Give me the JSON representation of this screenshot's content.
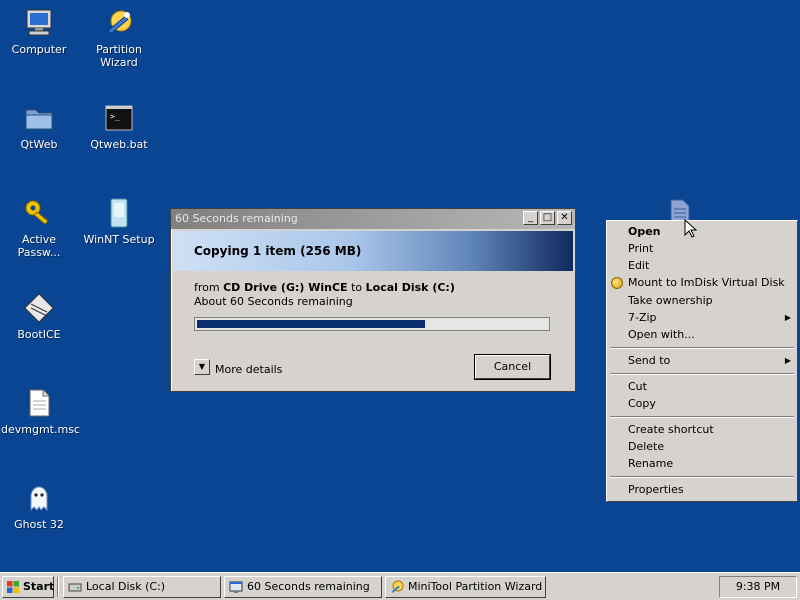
{
  "desktop": {
    "icons": [
      {
        "label": "Computer",
        "icon": "computer-icon"
      },
      {
        "label": "Partition Wizard",
        "icon": "wand-icon"
      },
      {
        "label": "QtWeb",
        "icon": "folder-icon"
      },
      {
        "label": "Qtweb.bat",
        "icon": "batch-file-icon"
      },
      {
        "label": "Active Passw...",
        "icon": "key-icon"
      },
      {
        "label": "WinNT Setup",
        "icon": "setup-icon"
      },
      {
        "label": "BootICE",
        "icon": "bootice-icon"
      },
      {
        "label": "devmgmt.msc",
        "icon": "document-icon"
      },
      {
        "label": "Ghost 32",
        "icon": "ghost-icon"
      }
    ]
  },
  "dialog": {
    "title": "60 Seconds remaining",
    "heading": "Copying 1 item (256 MB)",
    "from_prefix": "from",
    "source": "CD Drive (G:) WinCE",
    "to_word": "to",
    "destination": "Local Disk (C:)",
    "remaining": "About 60 Seconds remaining",
    "progress": 0.65,
    "more_details": "More details",
    "cancel": "Cancel",
    "minimize": "_",
    "maximize": "□",
    "close": "✕"
  },
  "context_menu": {
    "open": "Open",
    "print": "Print",
    "edit": "Edit",
    "mount": "Mount to ImDisk Virtual Disk",
    "take_ownership": "Take ownership",
    "zip": "7-Zip",
    "open_with": "Open with...",
    "send_to": "Send to",
    "cut": "Cut",
    "copy": "Copy",
    "create_shortcut": "Create shortcut",
    "delete": "Delete",
    "rename": "Rename",
    "properties": "Properties"
  },
  "taskbar": {
    "start": "Start",
    "tasks": [
      {
        "label": "Local Disk (C:)"
      },
      {
        "label": "60 Seconds remaining"
      },
      {
        "label": "MiniTool Partition Wizard ..."
      }
    ],
    "clock": "9:38 PM"
  },
  "colors": {
    "desktop": "#0a4593",
    "progress": "#0a2d6e"
  }
}
